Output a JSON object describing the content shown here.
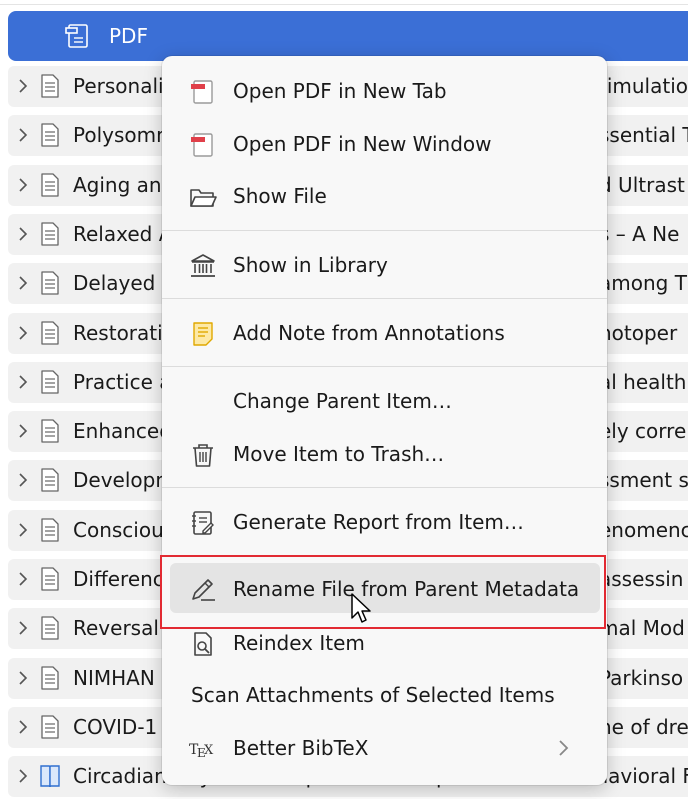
{
  "attachment": {
    "label": "PDF"
  },
  "items": [
    {
      "title": "Personali",
      "title_right": "timulatio",
      "icon": "document-icon"
    },
    {
      "title": "Polysomn",
      "title_right": "ssential T",
      "icon": "document-icon"
    },
    {
      "title": "Aging an",
      "title_right": "d Ultrast",
      "icon": "document-icon"
    },
    {
      "title": "Relaxed A",
      "title_right": "s – A Ne",
      "icon": "document-icon"
    },
    {
      "title": "Delayed",
      "title_right": "among T",
      "icon": "document-icon"
    },
    {
      "title": "Restorati",
      "title_right": "hotoper",
      "icon": "document-icon"
    },
    {
      "title": "Practice a",
      "title_right": "al health",
      "icon": "document-icon"
    },
    {
      "title": "Enhanced",
      "title_right": "ely corre",
      "icon": "document-icon"
    },
    {
      "title": "Developn",
      "title_right": "ssment s",
      "icon": "document-icon"
    },
    {
      "title": "Consciou",
      "title_right": "enomenc",
      "icon": "document-icon"
    },
    {
      "title": "Differenc",
      "title_right": "assessin",
      "icon": "document-icon"
    },
    {
      "title": "Reversal",
      "title_right": "mal Mod",
      "icon": "document-icon"
    },
    {
      "title": "NIMHAN",
      "title_right": "Parkinso",
      "icon": "document-icon"
    },
    {
      "title": "COVID-1",
      "title_right": "ne of dre",
      "icon": "document-icon"
    },
    {
      "title": "Circadian Rhythm Manipulations: Implications on Behavioral F",
      "title_right": "",
      "icon": "book-icon"
    }
  ],
  "menu": {
    "open_new_tab": "Open PDF in New Tab",
    "open_new_window": "Open PDF in New Window",
    "show_file": "Show File",
    "show_in_library": "Show in Library",
    "add_note": "Add Note from Annotations",
    "change_parent": "Change Parent Item…",
    "move_trash": "Move Item to Trash…",
    "generate_report": "Generate Report from Item…",
    "rename_file": "Rename File from Parent Metadata",
    "reindex": "Reindex Item",
    "scan_attachments": "Scan Attachments of Selected Items",
    "better_bibtex": "Better BibTeX"
  },
  "colors": {
    "selection": "#3b6fd6",
    "highlight_border": "#e22a32",
    "pdf_icon_red": "#e0404a",
    "note_yellow": "#f5c33b"
  }
}
